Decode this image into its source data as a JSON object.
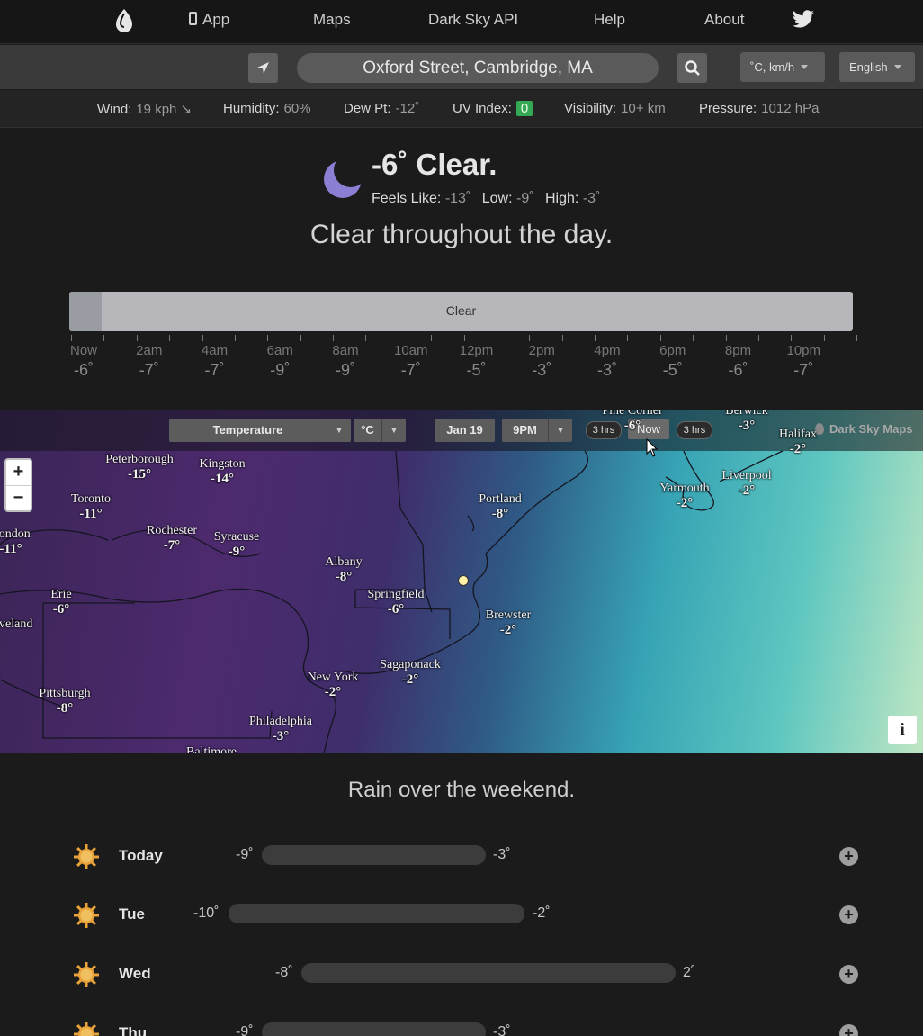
{
  "nav": {
    "app": "App",
    "maps": "Maps",
    "api": "Dark Sky API",
    "help": "Help",
    "about": "About"
  },
  "search": {
    "value": "Oxford Street, Cambridge, MA",
    "units": "˚C, km/h",
    "language": "English"
  },
  "stats": {
    "wind_label": "Wind:",
    "wind_value": "19 kph ↘",
    "humidity_label": "Humidity:",
    "humidity_value": "60%",
    "dew_label": "Dew Pt:",
    "dew_value": "-12˚",
    "uv_label": "UV Index:",
    "uv_value": "0",
    "vis_label": "Visibility:",
    "vis_value": "10+ km",
    "pressure_label": "Pressure:",
    "pressure_value": "1012 hPa"
  },
  "current": {
    "headline": "-6˚ Clear.",
    "feels_label": "Feels Like:",
    "feels_value": "-13˚",
    "low_label": "Low:",
    "low_value": "-9˚",
    "high_label": "High:",
    "high_value": "-3˚",
    "summary": "Clear throughout the day."
  },
  "timeline": {
    "bar_label": "Clear",
    "hours": [
      {
        "label": "Now",
        "temp": "-6˚"
      },
      {
        "label": "2am",
        "temp": "-7˚"
      },
      {
        "label": "4am",
        "temp": "-7˚"
      },
      {
        "label": "6am",
        "temp": "-9˚"
      },
      {
        "label": "8am",
        "temp": "-9˚"
      },
      {
        "label": "10am",
        "temp": "-7˚"
      },
      {
        "label": "12pm",
        "temp": "-5˚"
      },
      {
        "label": "2pm",
        "temp": "-3˚"
      },
      {
        "label": "4pm",
        "temp": "-3˚"
      },
      {
        "label": "6pm",
        "temp": "-5˚"
      },
      {
        "label": "8pm",
        "temp": "-6˚"
      },
      {
        "label": "10pm",
        "temp": "-7˚"
      }
    ]
  },
  "map": {
    "layer": "Temperature",
    "unit": "°C",
    "date": "Jan 19",
    "time": "9PM",
    "step_back": "3 hrs",
    "now": "Now",
    "step_fwd": "3 hrs",
    "brand": "Dark Sky Maps",
    "zoom_in": "+",
    "zoom_out": "−",
    "info": "i",
    "cities": [
      {
        "name": "Pine Corner",
        "temp": "-6°"
      },
      {
        "name": "Berwick",
        "temp": "-3°"
      },
      {
        "name": "Halifax",
        "temp": "-2°"
      },
      {
        "name": "Peterborough",
        "temp": "-15°"
      },
      {
        "name": "Kingston",
        "temp": "-14°"
      },
      {
        "name": "Toronto",
        "temp": "-11°"
      },
      {
        "name": "London",
        "temp": "-11°"
      },
      {
        "name": "Rochester",
        "temp": "-7°"
      },
      {
        "name": "Syracuse",
        "temp": "-9°"
      },
      {
        "name": "Portland",
        "temp": "-8°"
      },
      {
        "name": "Yarmouth",
        "temp": "-2°"
      },
      {
        "name": "Liverpool",
        "temp": "-2°"
      },
      {
        "name": "Albany",
        "temp": "-8°"
      },
      {
        "name": "Erie",
        "temp": "-6°"
      },
      {
        "name": "Springfield",
        "temp": "-6°"
      },
      {
        "name": "Brewster",
        "temp": "-2°"
      },
      {
        "name": "Cleveland",
        "temp": ""
      },
      {
        "name": "New York",
        "temp": "-2°"
      },
      {
        "name": "Sagaponack",
        "temp": "-2°"
      },
      {
        "name": "Pittsburgh",
        "temp": "-8°"
      },
      {
        "name": "Philadelphia",
        "temp": "-3°"
      },
      {
        "name": "Baltimore",
        "temp": ""
      }
    ]
  },
  "week": {
    "summary": "Rain over the weekend.",
    "days": [
      {
        "name": "Today",
        "low": "-9˚",
        "high": "-3˚"
      },
      {
        "name": "Tue",
        "low": "-10˚",
        "high": "-2˚"
      },
      {
        "name": "Wed",
        "low": "-8˚",
        "high": "2˚"
      },
      {
        "name": "Thu",
        "low": "-9˚",
        "high": "-3˚"
      }
    ]
  },
  "colors": {
    "uv_badge": "#34a853",
    "moon": "#8b7fd4",
    "sun": "#e8a33a"
  }
}
